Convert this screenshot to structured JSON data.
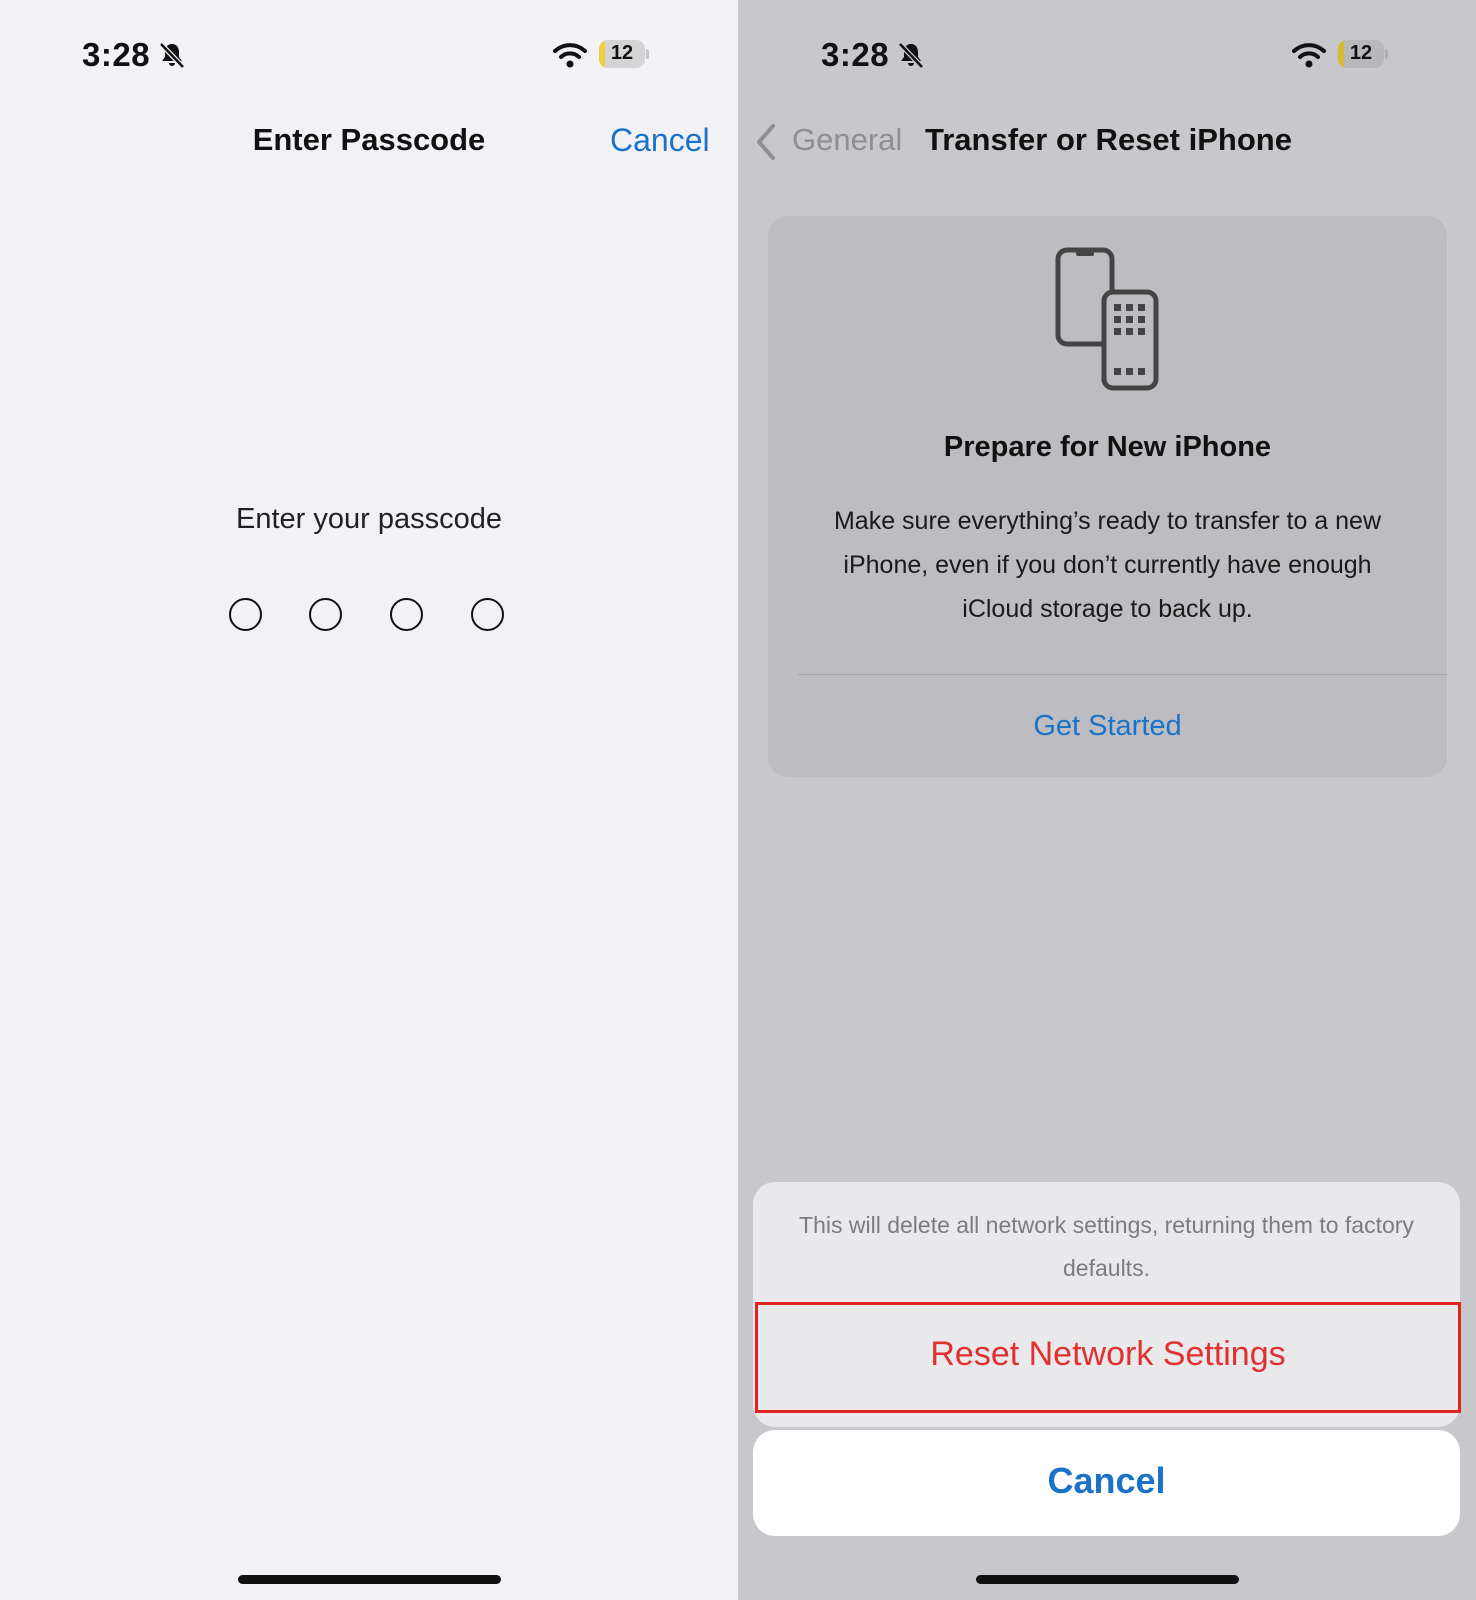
{
  "colors": {
    "accent_blue": "#1a73c9",
    "destructive_red": "#e03030",
    "highlight_box": "#e02424"
  },
  "left": {
    "status_bar": {
      "time": "3:28",
      "battery": "12",
      "icons": [
        "bell-slash-icon",
        "wifi-icon",
        "battery-icon"
      ]
    },
    "nav": {
      "title": "Enter Passcode",
      "cancel_label": "Cancel"
    },
    "passcode": {
      "prompt": "Enter your passcode",
      "entered_digits": 0,
      "total_digits": 4
    }
  },
  "right": {
    "status_bar": {
      "time": "3:28",
      "battery": "12",
      "icons": [
        "bell-slash-icon",
        "wifi-icon",
        "battery-icon"
      ]
    },
    "nav": {
      "back_label": "General",
      "title": "Transfer or Reset iPhone"
    },
    "card": {
      "icon": "transfer-phones-icon",
      "title": "Prepare for New iPhone",
      "body": "Make sure everything’s ready to transfer to a new iPhone, even if you don’t currently have enough iCloud storage to back up.",
      "action_label": "Get Started"
    },
    "action_sheet": {
      "message": "This will delete all network settings, returning them to factory defaults.",
      "destructive_label": "Reset Network Settings",
      "cancel_label": "Cancel"
    }
  }
}
